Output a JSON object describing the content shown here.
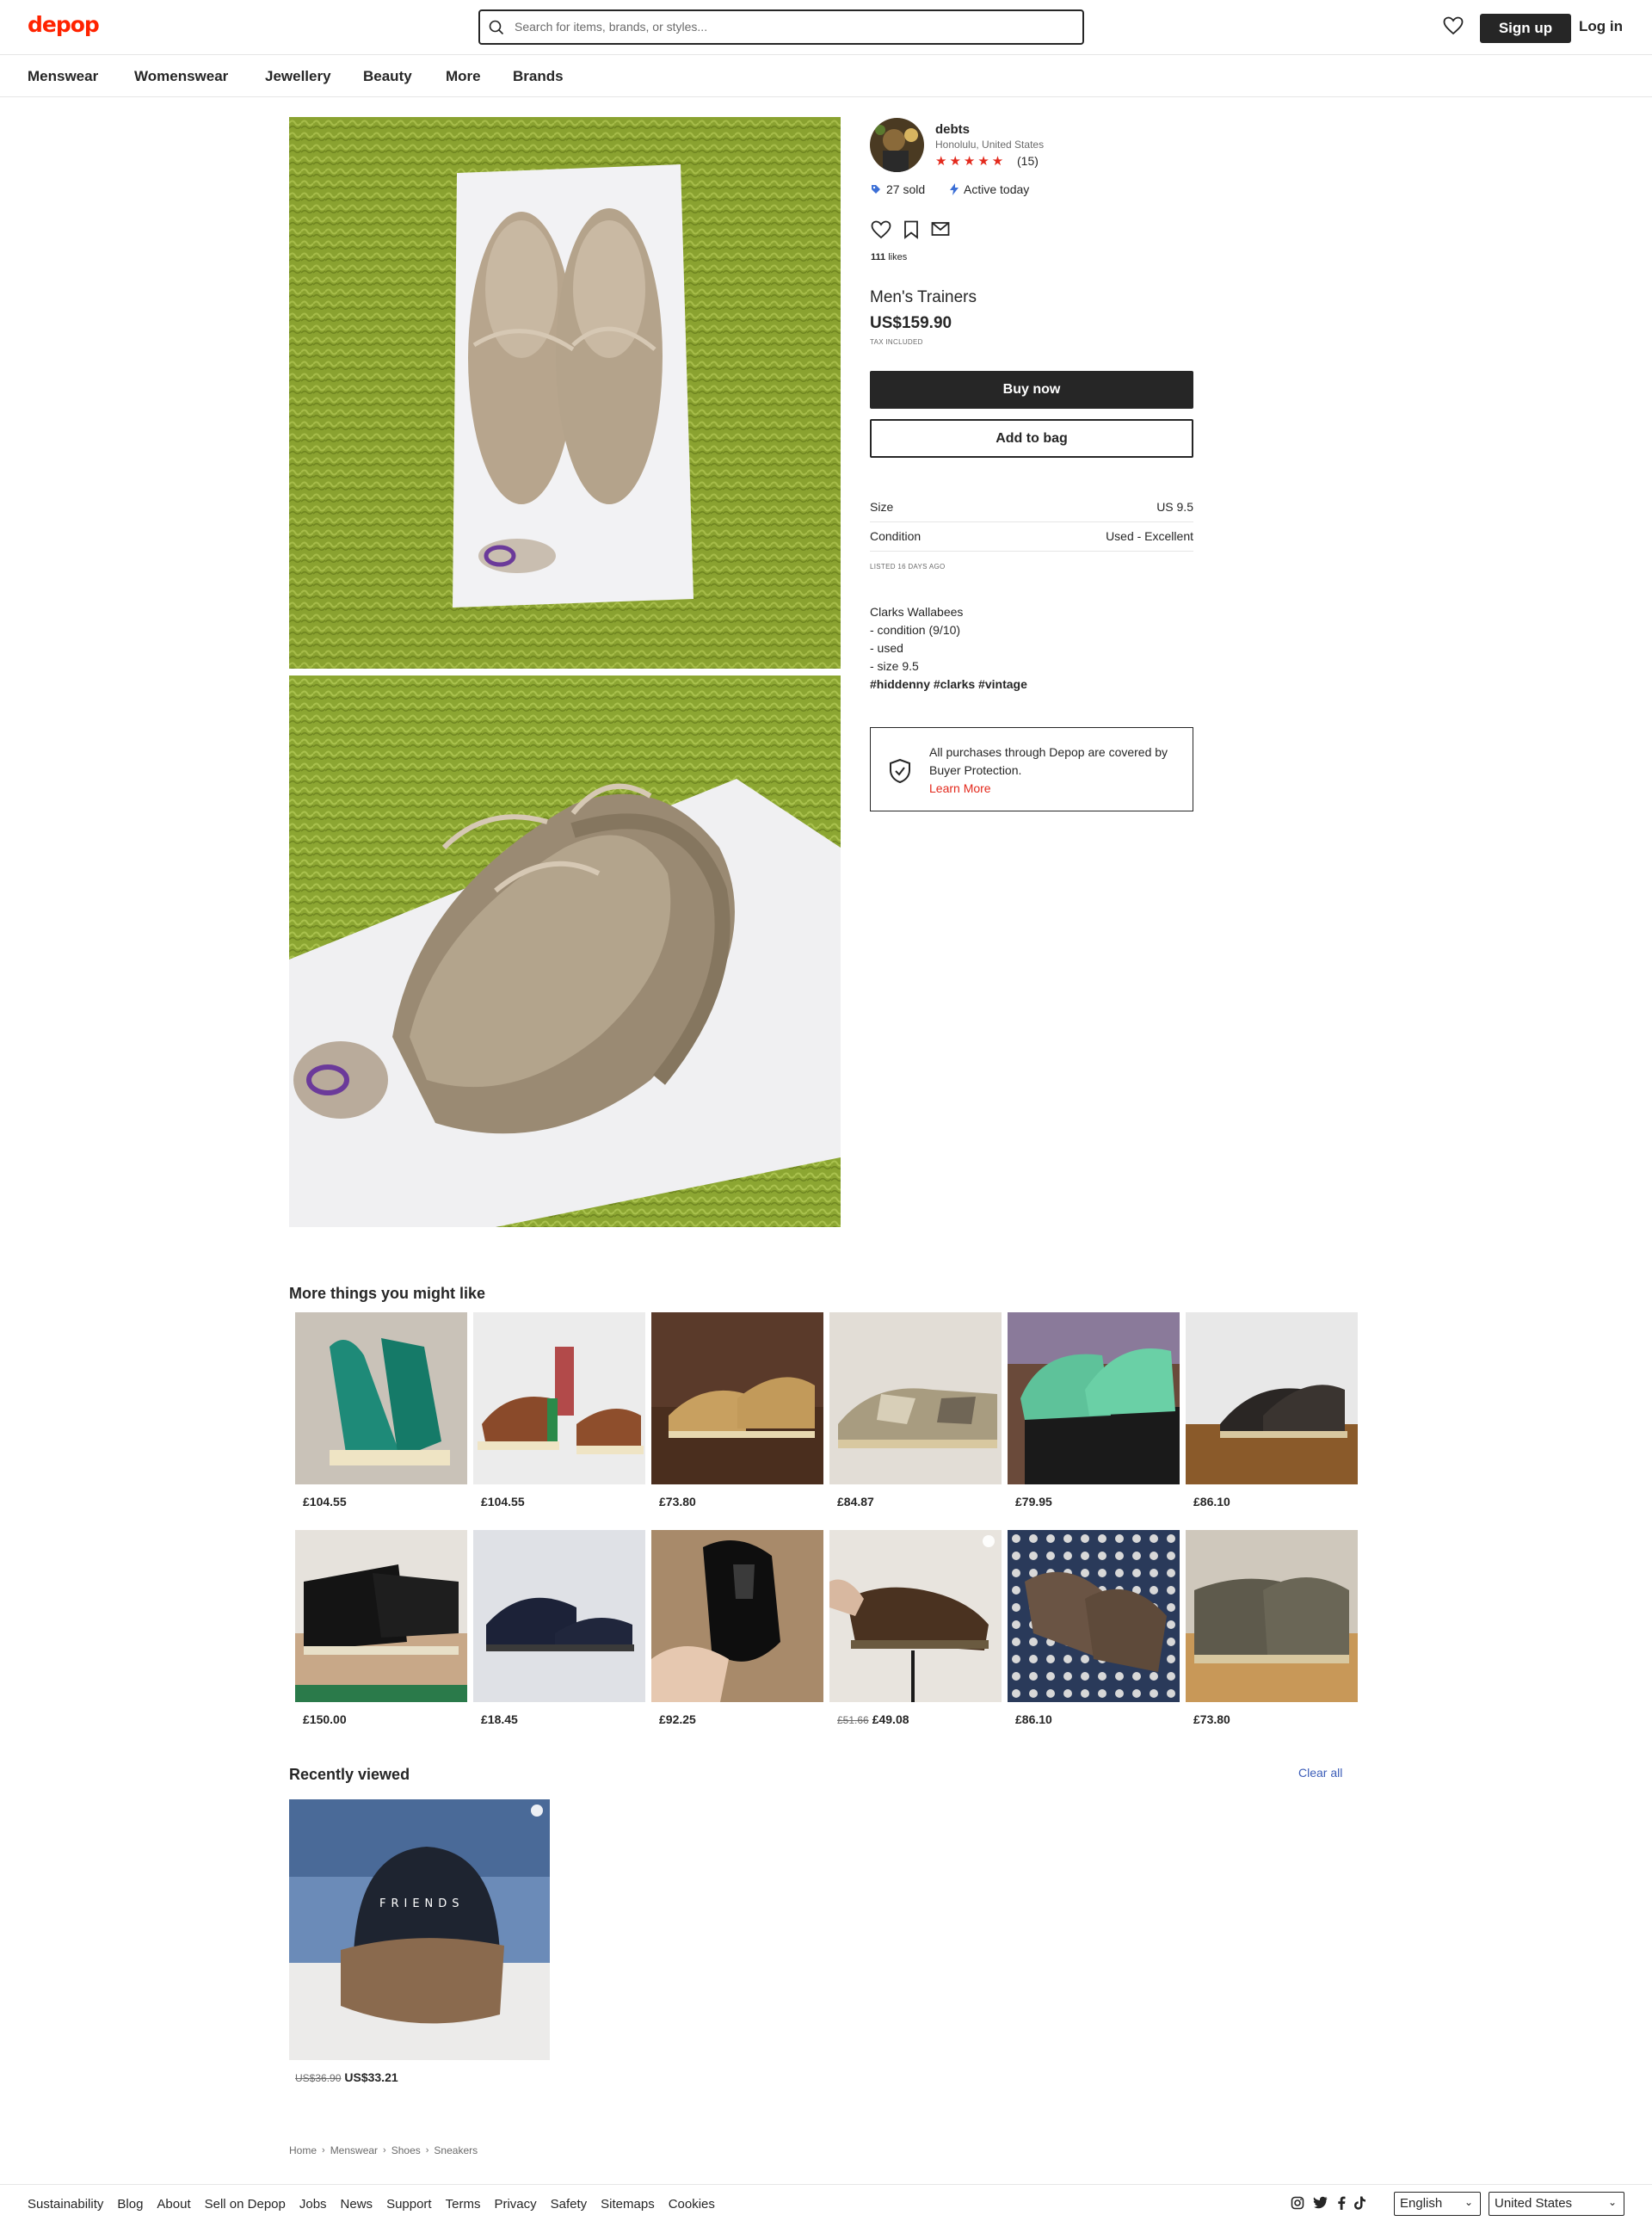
{
  "brand": {
    "logo": "depop",
    "accent": "#ff2300"
  },
  "header": {
    "search_placeholder": "Search for items, brands, or styles...",
    "signup_label": "Sign up",
    "login_label": "Log in"
  },
  "nav": [
    "Menswear",
    "Womenswear",
    "Jewellery",
    "Beauty",
    "More",
    "Brands"
  ],
  "seller": {
    "name": "debts",
    "location": "Honolulu, United States",
    "rating_stars": 5,
    "review_count": "(15)",
    "sold": "27 sold",
    "activity": "Active today"
  },
  "likes": {
    "count": "111",
    "label": "likes"
  },
  "product": {
    "title": "Men's Trainers",
    "price": "US$159.90",
    "tax_note": "TAX INCLUDED",
    "buy_label": "Buy now",
    "bag_label": "Add to bag",
    "attributes": [
      {
        "key": "Size",
        "value": "US 9.5"
      },
      {
        "key": "Condition",
        "value": "Used - Excellent"
      }
    ],
    "listed": "LISTED 16 DAYS AGO",
    "description": [
      "Clarks Wallabees",
      "- condition (9/10)",
      "- used",
      "- size 9.5"
    ],
    "hashtags": "#hiddenny #clarks #vintage"
  },
  "protection": {
    "text": "All purchases through Depop are covered by Buyer Protection.",
    "link": "Learn More"
  },
  "more": {
    "title": "More things you might like",
    "items": [
      {
        "price": "£104.55"
      },
      {
        "price": "£104.55"
      },
      {
        "price": "£73.80"
      },
      {
        "price": "£84.87"
      },
      {
        "price": "£79.95"
      },
      {
        "price": "£86.10"
      },
      {
        "price": "£150.00"
      },
      {
        "price": "£18.45"
      },
      {
        "price": "£92.25"
      },
      {
        "old_price": "£51.66",
        "price": "£49.08"
      },
      {
        "price": "£86.10"
      },
      {
        "price": "£73.80"
      }
    ]
  },
  "recent": {
    "title": "Recently viewed",
    "clear": "Clear all",
    "item": {
      "old_price": "US$36.90",
      "price": "US$33.21"
    }
  },
  "breadcrumb": [
    "Home",
    "Menswear",
    "Shoes",
    "Sneakers"
  ],
  "footer": {
    "links": [
      "Sustainability",
      "Blog",
      "About",
      "Sell on Depop",
      "Jobs",
      "News",
      "Support",
      "Terms",
      "Privacy",
      "Safety",
      "Sitemaps",
      "Cookies"
    ],
    "social_icons": [
      "instagram-icon",
      "twitter-icon",
      "facebook-icon",
      "tiktok-icon"
    ],
    "language": "English",
    "country": "United States"
  }
}
